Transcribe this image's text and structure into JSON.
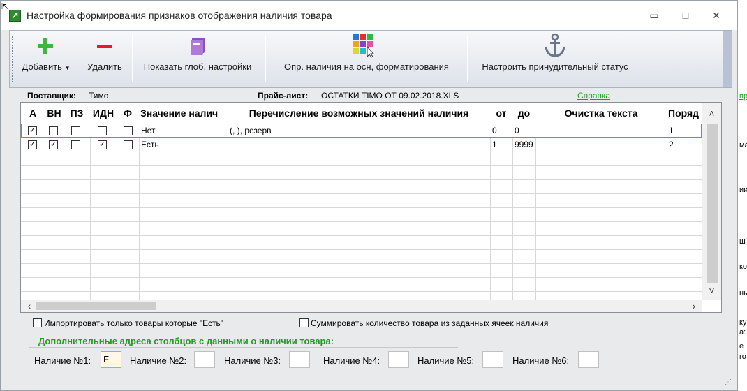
{
  "window": {
    "title": "Настройка формирования признаков отображения наличия товара",
    "minimize": "▭",
    "maximize": "□",
    "close": "✕"
  },
  "toolbar": {
    "add_label": "Добавить",
    "delete_label": "Удалить",
    "global_settings_label": "Показать глоб. настройки",
    "format_label": "Опр. наличия на осн, форматирования",
    "status_label": "Настроить принудительный статус"
  },
  "info": {
    "supplier_label": "Поставщик:",
    "supplier_value": "Тимо",
    "pricelist_label": "Прайс-лист:",
    "pricelist_value": "ОСТАТКИ TIMO ОТ 09.02.2018.XLS",
    "help_link": "Справка"
  },
  "grid": {
    "columns": [
      "А",
      "ВН",
      "ПЗ",
      "ИДН",
      "Ф",
      "Значение налич",
      "Перечисление возможных значений наличия",
      "от",
      "до",
      "Очистка текста",
      "Поряд"
    ],
    "rows": [
      {
        "a": true,
        "vn": false,
        "pz": false,
        "idn": false,
        "f": false,
        "value": "Нет",
        "enum": "(, ), резерв",
        "from": "0",
        "to": "0",
        "clean": "",
        "order": "1"
      },
      {
        "a": true,
        "vn": true,
        "pz": false,
        "idn": true,
        "f": false,
        "value": "Есть",
        "enum": "",
        "from": "1",
        "to": "9999",
        "clean": "",
        "order": "2"
      }
    ]
  },
  "options": {
    "import_only": "Импортировать только товары которые \"Есть\"",
    "sum_qty": "Суммировать количество товара из заданных ячеек наличия"
  },
  "additional": {
    "header": "Дополнительные адреса столбцов с данными о наличии товара:",
    "fields": [
      {
        "label": "Наличие №1:",
        "value": "F"
      },
      {
        "label": "Наличие №2:",
        "value": ""
      },
      {
        "label": "Наличие №3:",
        "value": ""
      },
      {
        "label": "Наличие №4:",
        "value": ""
      },
      {
        "label": "Наличие №5:",
        "value": ""
      },
      {
        "label": "Наличие №6:",
        "value": ""
      }
    ]
  },
  "background_window": {
    "link": "пр",
    "texts": [
      "ма",
      "ии",
      "ш",
      "ко",
      "ны",
      "ку",
      "а:",
      "е",
      "го"
    ]
  },
  "colors": {
    "accent_green": "#1f9e1f",
    "selection_border": "#3399ff"
  }
}
